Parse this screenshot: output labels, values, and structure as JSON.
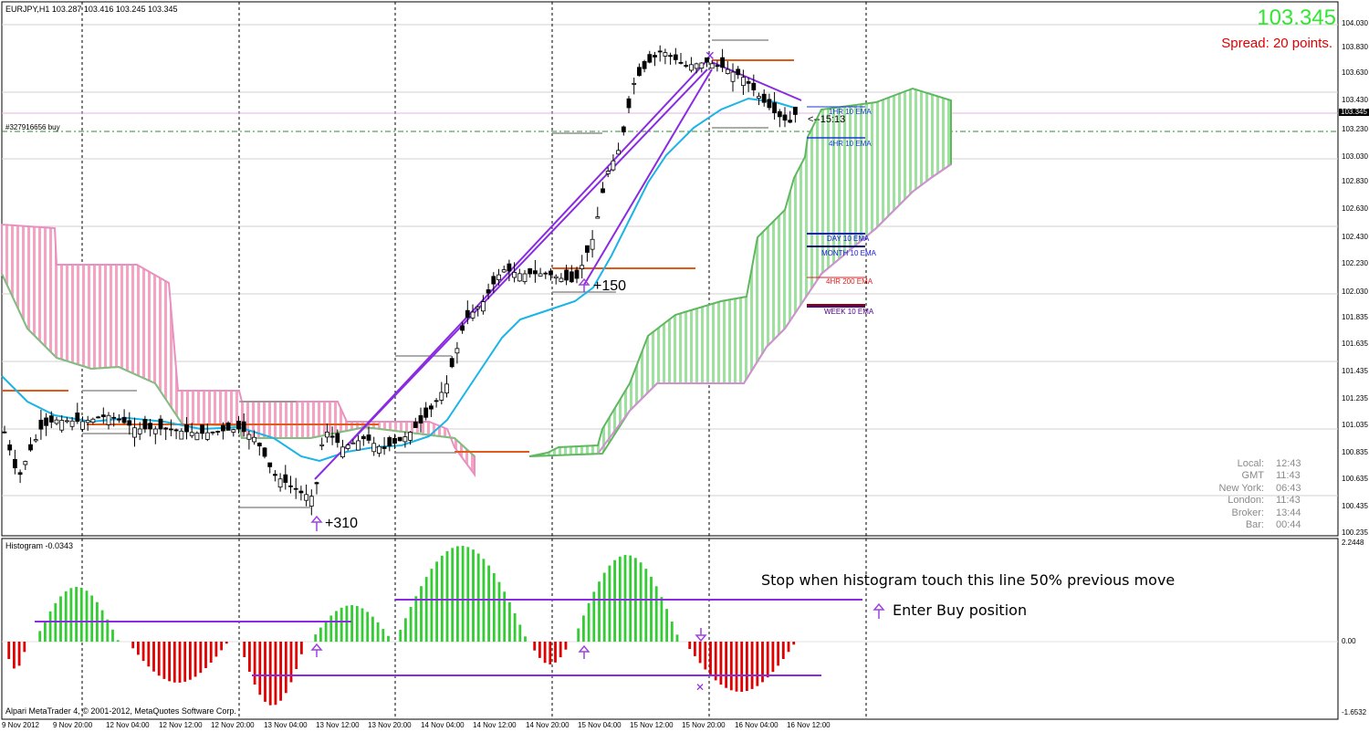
{
  "header": {
    "symbol_info": "EURJPY,H1  103.287 103.416 103.245 103.345"
  },
  "price_display": {
    "price": "103.345",
    "spread": "Spread: 20 points."
  },
  "order_label": "#327916656 buy",
  "ema_labels": {
    "hr1": "1HR 10 EMA",
    "hr4": "4HR 10 EMA",
    "day": "DAY 10 EMA",
    "month": "MONTH 10 EMA",
    "hr4_200": "4HR 200 EMA",
    "week": "WEEK 10 EMA"
  },
  "timer": "<--15:13",
  "signals": {
    "s1": "+310",
    "s2": "+150"
  },
  "clock": {
    "labels": [
      "Local:",
      "GMT",
      "New York:",
      "London:",
      "Broker:",
      "Bar:"
    ],
    "values": [
      "12:43",
      "11:43",
      "06:43",
      "11:43",
      "13:44",
      "00:44"
    ]
  },
  "histogram": {
    "title": "Histogram -0.0343"
  },
  "annotations": {
    "stop": "Stop when histogram touch this line 50% previous move",
    "enter": "Enter Buy position"
  },
  "copyright": "Alpari MetaTrader 4, © 2001-2012, MetaQuotes Software Corp.",
  "price_axis": {
    "main": [
      "104.030",
      "103.830",
      "103.630",
      "103.430",
      "103.345",
      "103.230",
      "103.030",
      "102.830",
      "102.630",
      "102.430",
      "102.230",
      "102.030",
      "101.835",
      "101.635",
      "101.435",
      "101.235",
      "101.035",
      "100.835",
      "100.635",
      "100.435",
      "100.235"
    ],
    "hist": [
      "2.2448",
      "0.00",
      "-1.6532"
    ]
  },
  "time_axis": [
    "9 Nov 2012",
    "9 Nov 20:00",
    "12 Nov 04:00",
    "12 Nov 12:00",
    "12 Nov 20:00",
    "13 Nov 04:00",
    "13 Nov 12:00",
    "13 Nov 20:00",
    "14 Nov 04:00",
    "14 Nov 12:00",
    "14 Nov 20:00",
    "15 Nov 04:00",
    "15 Nov 12:00",
    "15 Nov 20:00",
    "16 Nov 04:00",
    "16 Nov 12:00"
  ],
  "colors": {
    "bull": "#33cc33",
    "bear": "#e00000",
    "cloud_up": "#9ee09e",
    "cloud_dn": "#f4a3c3",
    "ema": "#1ab4e6",
    "trend": "#8a2be2",
    "grid": "#000000"
  }
}
